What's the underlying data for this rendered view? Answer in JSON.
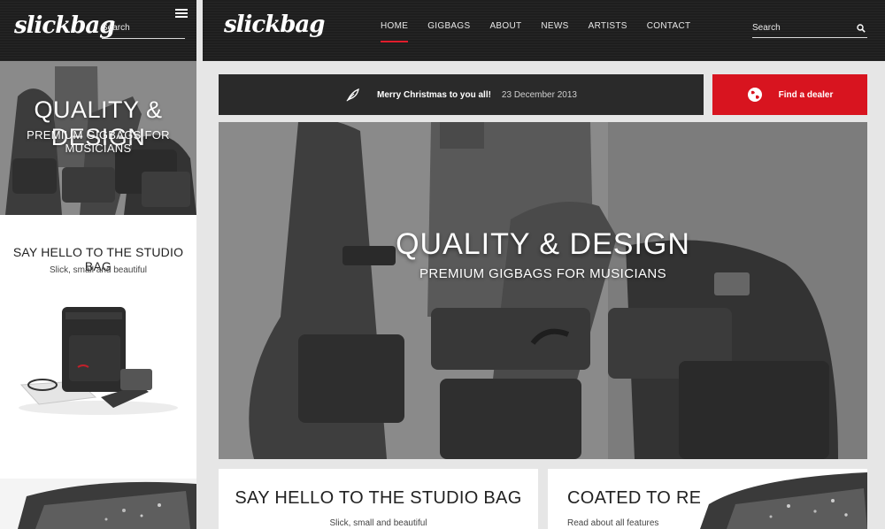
{
  "brand": {
    "logo_text": "slickbag",
    "accent_color": "#d8141f",
    "header_color": "#1e1e1e"
  },
  "mobile": {
    "search_placeholder": "Search",
    "menu_icon": "hamburger-menu-icon",
    "hero": {
      "title": "QUALITY & DESIGN",
      "subtitle": "PREMIUM GIGBAGS FOR MUSICIANS"
    },
    "card": {
      "title": "SAY HELLO TO THE STUDIO BAG",
      "subtitle": "Slick, small and beautiful"
    }
  },
  "desktop": {
    "nav": [
      {
        "label": "HOME",
        "active": true
      },
      {
        "label": "GIGBAGS"
      },
      {
        "label": "ABOUT"
      },
      {
        "label": "NEWS"
      },
      {
        "label": "ARTISTS"
      },
      {
        "label": "CONTACT"
      }
    ],
    "search_placeholder": "Search",
    "news": {
      "title": "Merry Christmas to you all!",
      "date": "23 December 2013",
      "icon": "feather-icon"
    },
    "dealer": {
      "label": "Find a dealer",
      "icon": "globe-icon"
    },
    "hero": {
      "title": "QUALITY & DESIGN",
      "subtitle": "PREMIUM GIGBAGS FOR MUSICIANS"
    },
    "cards": [
      {
        "title": "SAY HELLO TO THE STUDIO BAG",
        "subtitle": "Slick, small and beautiful"
      },
      {
        "title": "COATED TO RESIST",
        "subtitle": "Read about all features"
      }
    ]
  }
}
